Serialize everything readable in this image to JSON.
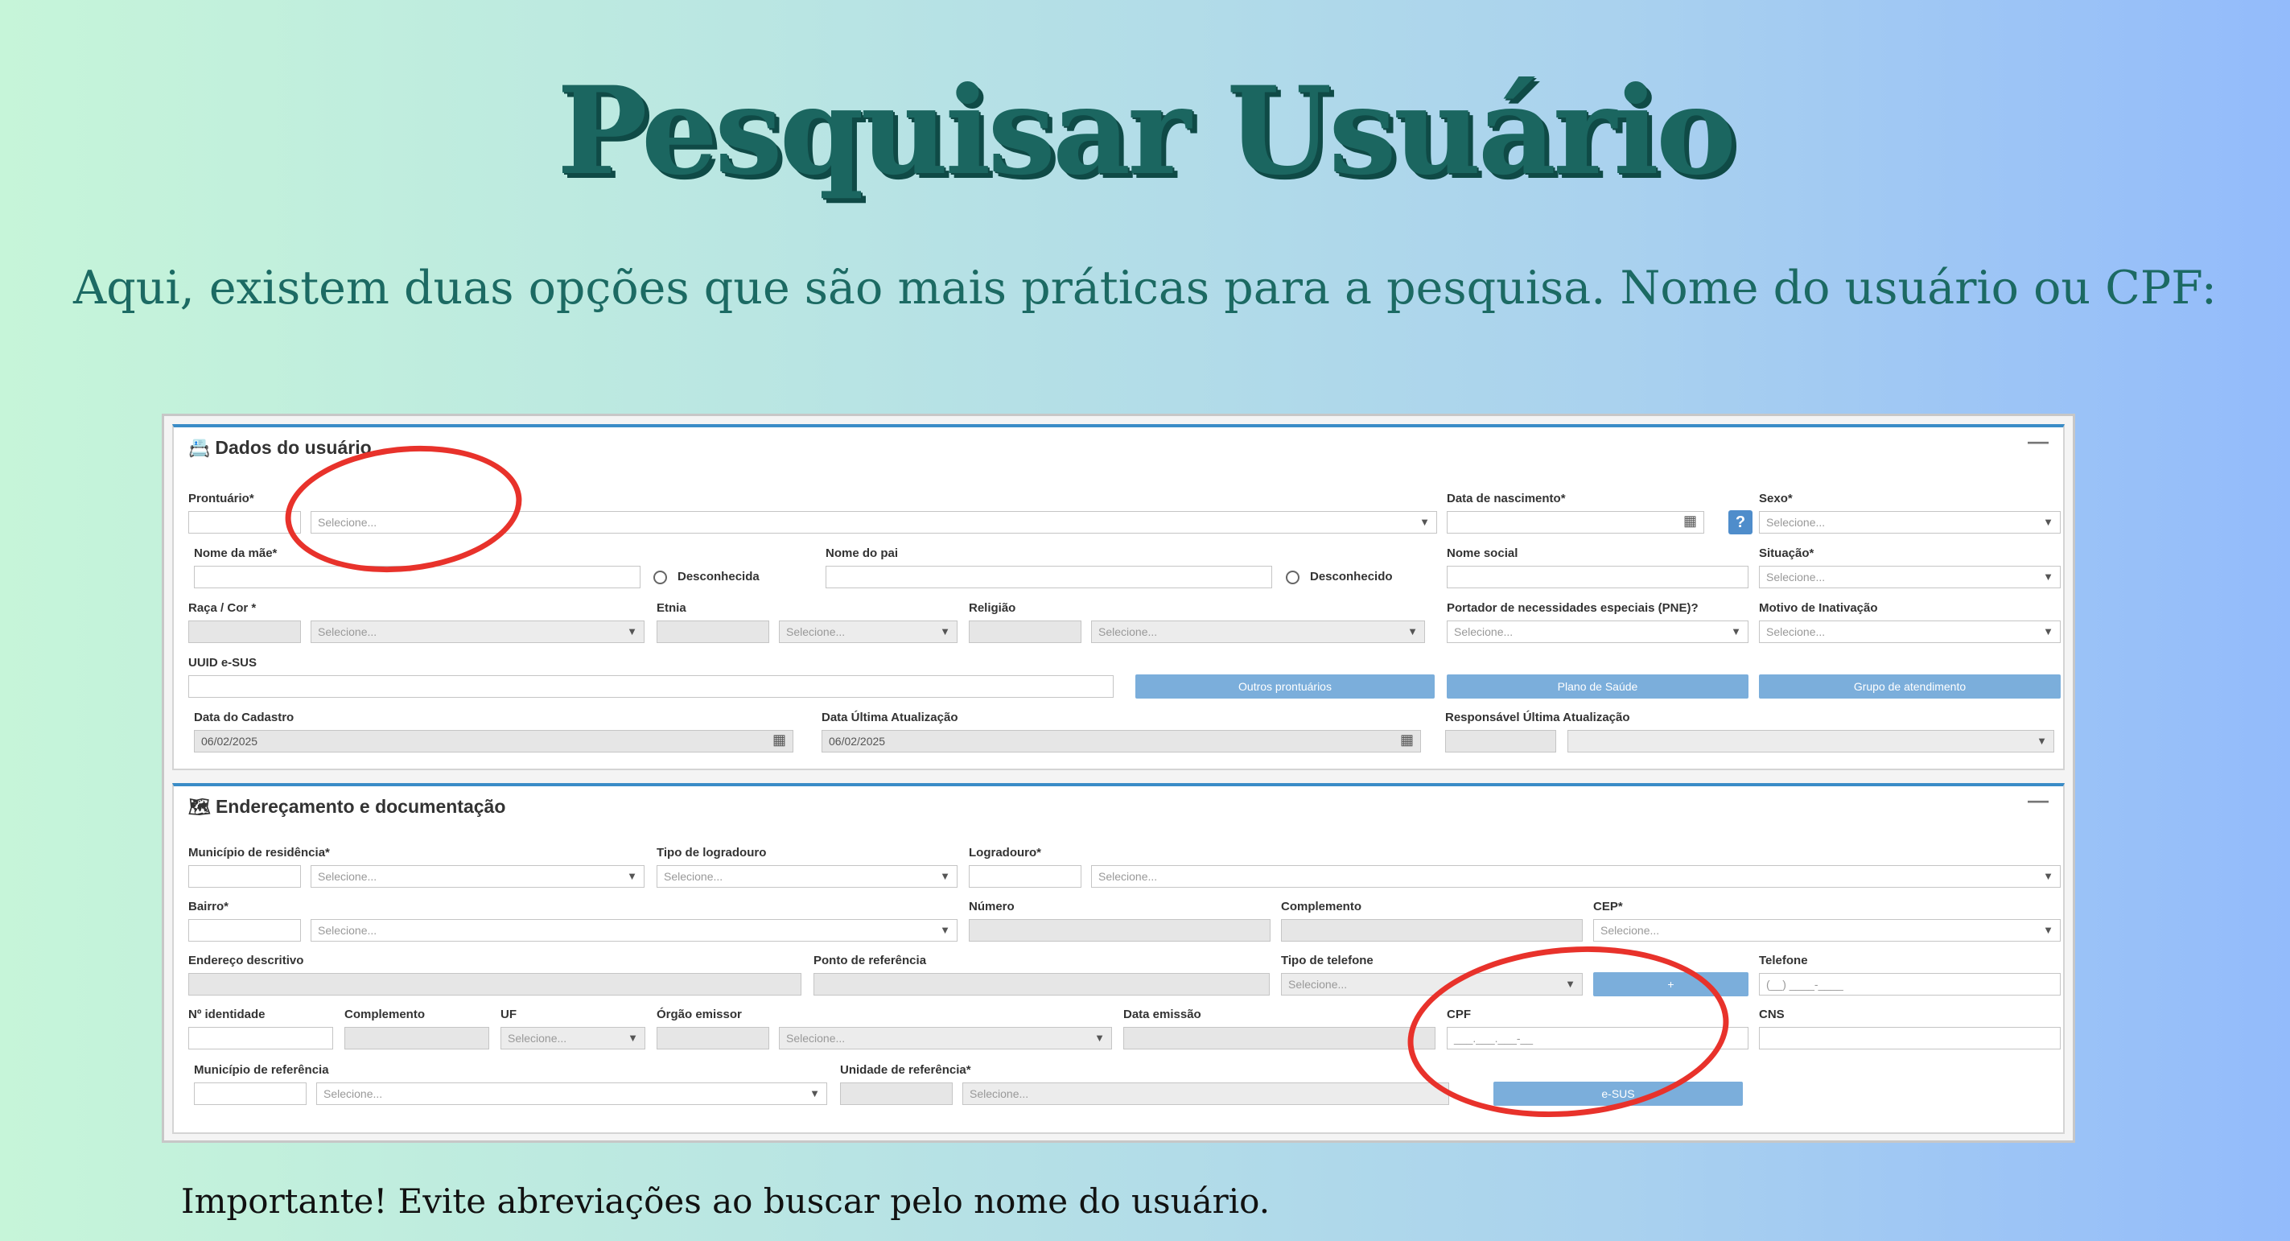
{
  "page": {
    "title": "Pesquisar Usuário",
    "subtitle": "Aqui, existem duas opções que são mais práticas para a pesquisa. Nome do usuário ou CPF:",
    "note": "Importante! Evite abreviações ao buscar pelo nome do usuário."
  },
  "colors": {
    "accent": "#3a8cc7",
    "button": "#7baedb",
    "highlight": "#e8322b",
    "title": "#1b6660"
  },
  "placeholders": {
    "select": "Selecione...",
    "cpf": "___.___.___-__",
    "phone": "(__) ____-____"
  },
  "dados": {
    "title": "Dados do usuário",
    "icon": "id-card-icon",
    "minimize": "—",
    "prontuario": "Prontuário*",
    "data_nascimento": "Data de nascimento*",
    "help": "?",
    "sexo": "Sexo*",
    "nome_mae": "Nome da mãe*",
    "desconhecida": "Desconhecida",
    "nome_pai": "Nome do pai",
    "desconhecido": "Desconhecido",
    "nome_social": "Nome social",
    "situacao": "Situação*",
    "raca": "Raça / Cor *",
    "etnia": "Etnia",
    "religiao": "Religião",
    "pne": "Portador de necessidades especiais (PNE)?",
    "motivo": "Motivo de Inativação",
    "uuid": "UUID e-SUS",
    "btn_outros": "Outros prontuários",
    "btn_plano": "Plano de Saúde",
    "btn_grupo": "Grupo de atendimento",
    "data_cadastro": "Data do Cadastro",
    "data_cadastro_value": "06/02/2025",
    "data_atualizacao": "Data Última Atualização",
    "data_atualizacao_value": "06/02/2025",
    "responsavel": "Responsável Última Atualização"
  },
  "endereco": {
    "title": "Endereçamento e documentação",
    "icon": "map-icon",
    "minimize": "—",
    "municipio": "Município de residência*",
    "tipo_logradouro": "Tipo de logradouro",
    "logradouro": "Logradouro*",
    "bairro": "Bairro*",
    "numero": "Número",
    "complemento": "Complemento",
    "cep": "CEP*",
    "endereco_descritivo": "Endereço descritivo",
    "ponto_referencia": "Ponto de referência",
    "tipo_telefone": "Tipo de telefone",
    "add_phone": "+",
    "telefone": "Telefone",
    "identidade": "Nº identidade",
    "complemento2": "Complemento",
    "uf": "UF",
    "orgao": "Órgão emissor",
    "data_emissao": "Data emissão",
    "cpf": "CPF",
    "cns": "CNS",
    "municipio_ref": "Município de referência",
    "unidade_ref": "Unidade de referência*",
    "btn_esus": "e-SUS"
  }
}
